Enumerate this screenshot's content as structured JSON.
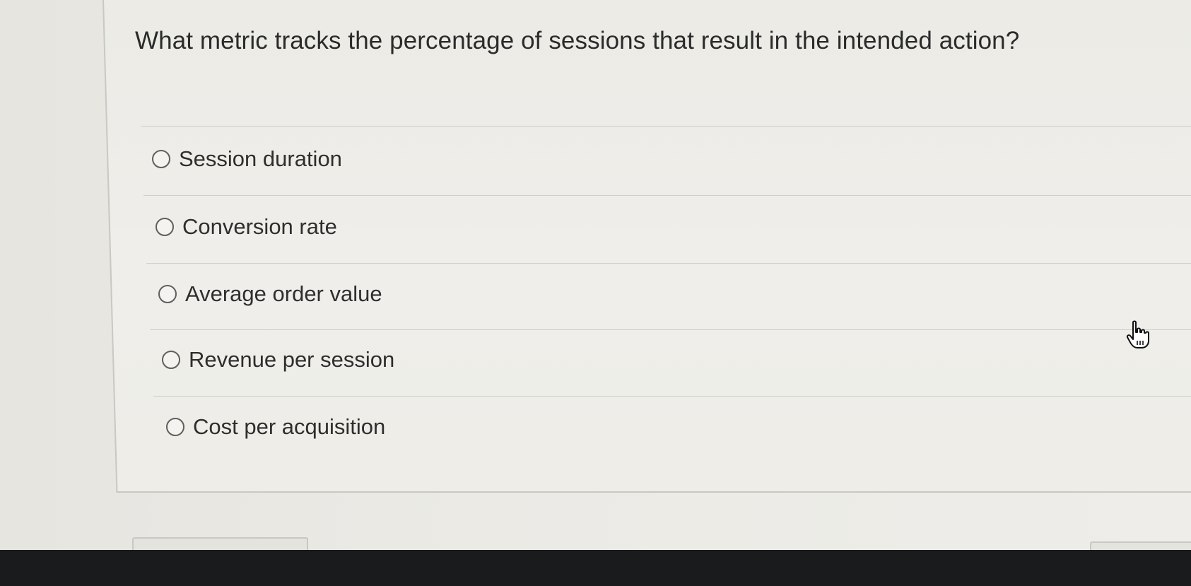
{
  "question": {
    "text": "What metric tracks the percentage of sessions that result in the intended action?"
  },
  "options": [
    {
      "label": "Session duration",
      "selected": false
    },
    {
      "label": "Conversion rate",
      "selected": false
    },
    {
      "label": "Average order value",
      "selected": false
    },
    {
      "label": "Revenue per session",
      "selected": false
    },
    {
      "label": "Cost per acquisition",
      "selected": false
    }
  ],
  "cursor": {
    "icon": "hand-pointer-icon"
  },
  "colors": {
    "background": "#ecebe6",
    "text": "#2b2b2b",
    "divider": "#cfcec8",
    "taskbar": "#1a1b1d"
  }
}
